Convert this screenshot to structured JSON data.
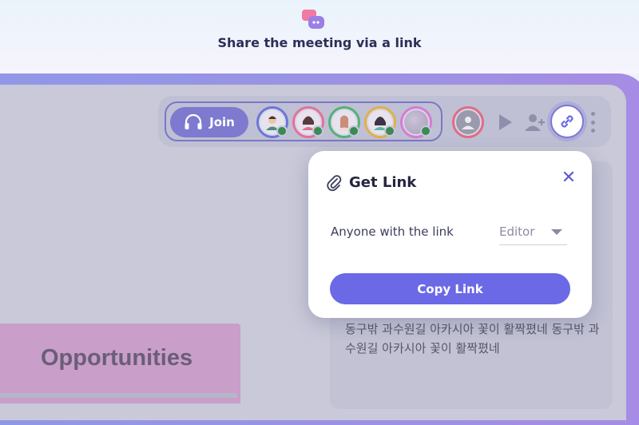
{
  "header": {
    "title": "Share the meeting via a link",
    "logo_icon": "chat-bubbles-icon"
  },
  "toolbar": {
    "join_label": "Join",
    "participants": [
      {
        "name": "participant-1",
        "ring": "#6b76d9"
      },
      {
        "name": "participant-2",
        "ring": "#e3719a"
      },
      {
        "name": "participant-3",
        "ring": "#55b07a"
      },
      {
        "name": "participant-4",
        "ring": "#e0b04a"
      },
      {
        "name": "participant-5",
        "ring": "#d77bd3"
      },
      {
        "name": "participant-6",
        "ring": "#e06c87"
      }
    ],
    "icons": [
      "headset-icon",
      "play-icon",
      "add-user-icon",
      "link-icon",
      "more-icon"
    ]
  },
  "popup": {
    "title": "Get Link",
    "permission_label": "Anyone with the link",
    "permission_value": "Editor",
    "copy_label": "Copy Link"
  },
  "content": {
    "korean_text": "동구밖 과수원길 아카시아 꽃이 활짝폈네 동구밖 과수원길 아카시아 꽃이 활짝폈네",
    "opportunities_label": "Opportunities"
  },
  "colors": {
    "accent": "#6b69e6",
    "brand": "#7d7ad0"
  }
}
